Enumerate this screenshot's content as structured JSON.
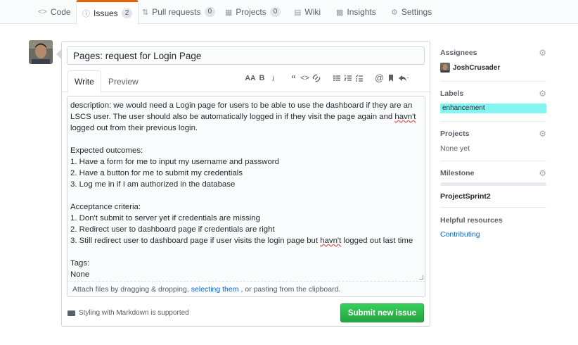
{
  "nav": {
    "tabs": [
      {
        "icon": "code-icon",
        "label": "Code"
      },
      {
        "icon": "issue-icon",
        "label": "Issues",
        "count": "2"
      },
      {
        "icon": "pull-request-icon",
        "label": "Pull requests",
        "count": "0"
      },
      {
        "icon": "project-icon",
        "label": "Projects",
        "count": "0"
      },
      {
        "icon": "wiki-icon",
        "label": "Wiki"
      },
      {
        "icon": "graph-icon",
        "label": "Insights"
      },
      {
        "icon": "gear-icon",
        "label": "Settings"
      }
    ]
  },
  "issue": {
    "title_value": "Pages: request for Login Page",
    "tab_write": "Write",
    "tab_preview": "Preview",
    "toolbar": {
      "heading": "AA",
      "bold": "B",
      "italic": "i"
    },
    "body_lines": {
      "l1": "description: we would need a Login page for users to be able to use the dashboard if they are an",
      "l2a": "LSCS user. The user should also be automatically logged in if they visit the page again and ",
      "l2b": "havn't",
      "l3": "logged out from their previous login.",
      "l4": "Expected outcomes:",
      "l5": "1. Have a form for me to input my username and password",
      "l6": "2. Have a button for me to submit my credentials",
      "l7": "3. Log me in if I am authorized in the database",
      "l8": "Acceptance criteria:",
      "l9": "1. Don't submit to server yet if credentials are missing",
      "l10": "2. Redirect user to dashboard page if credentials are right",
      "l11a": "3. Still redirect user to dashboard page if user visits the login page but ",
      "l11b": "havn't",
      "l11c": " logged out last time",
      "l12": "Tags:",
      "l13": "None"
    },
    "attach": {
      "before": "Attach files by dragging & dropping,",
      "link": "selecting them",
      "after": ", or pasting from the clipboard."
    },
    "markdown_note": "Styling with Markdown is supported",
    "submit_label": "Submit new issue"
  },
  "sidebar": {
    "assignees": {
      "heading": "Assignees",
      "user": "JoshCrusader"
    },
    "labels": {
      "heading": "Labels",
      "label": "enhancement",
      "label_color": "#84f5f1"
    },
    "projects": {
      "heading": "Projects",
      "value": "None yet"
    },
    "milestone": {
      "heading": "Milestone",
      "name": "ProjectSprint2",
      "progress": 0
    },
    "helpful": {
      "heading": "Helpful resources",
      "link": "Contributing"
    }
  },
  "colors": {
    "accent_tab": "#e36209",
    "submit_green": "#2cbe4e",
    "link": "#0366d6"
  }
}
